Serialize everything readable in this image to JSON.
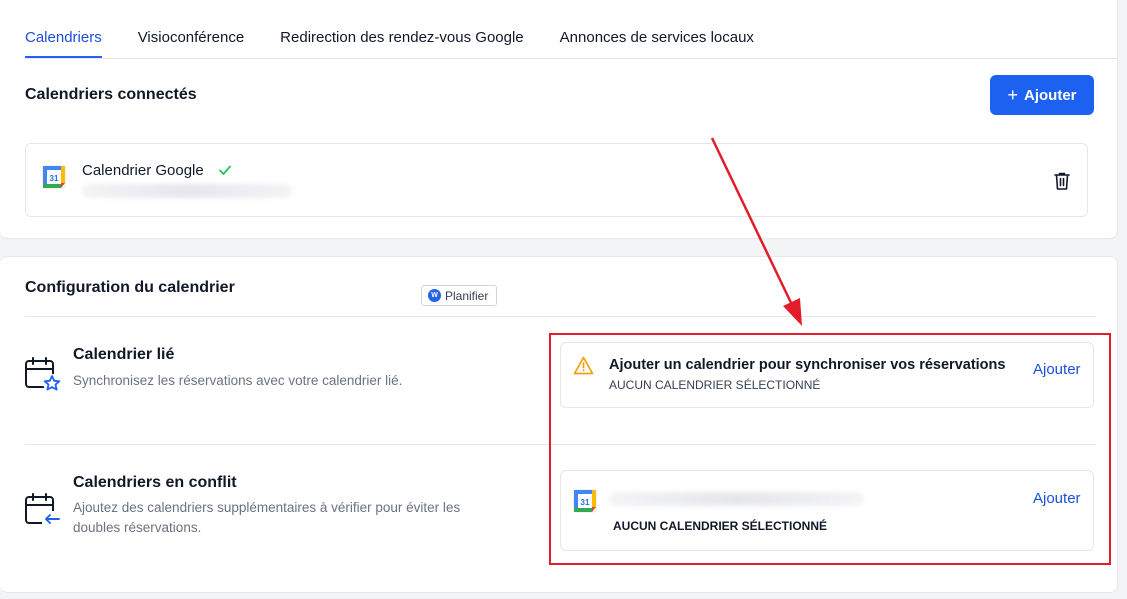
{
  "tabs": [
    {
      "label": "Calendriers",
      "active": true
    },
    {
      "label": "Visioconférence"
    },
    {
      "label": "Redirection des rendez-vous Google"
    },
    {
      "label": "Annonces de services locaux"
    }
  ],
  "connected": {
    "title": "Calendriers connectés",
    "add_button": "Ajouter",
    "items": [
      {
        "name": "Calendrier Google",
        "status": "connected"
      }
    ]
  },
  "config": {
    "title": "Configuration du calendrier",
    "badge": "Planifier",
    "linked": {
      "title": "Calendrier lié",
      "description": "Synchronisez les réservations avec votre calendrier lié.",
      "warning_title": "Ajouter un calendrier pour synchroniser vos réservations",
      "warning_sub": "AUCUN CALENDRIER SÉLECTIONNÉ",
      "action": "Ajouter"
    },
    "conflict": {
      "title": "Calendriers en conflit",
      "description_line1": "Ajoutez des calendriers supplémentaires à vérifier pour éviter les",
      "description_line2": "doubles réservations.",
      "status": "AUCUN CALENDRIER SÉLECTIONNÉ",
      "action": "Ajouter"
    }
  },
  "colors": {
    "accent": "#1d61f0",
    "annotation": "#e11d2a",
    "warning": "#f59e0b",
    "success": "#22c55e"
  }
}
